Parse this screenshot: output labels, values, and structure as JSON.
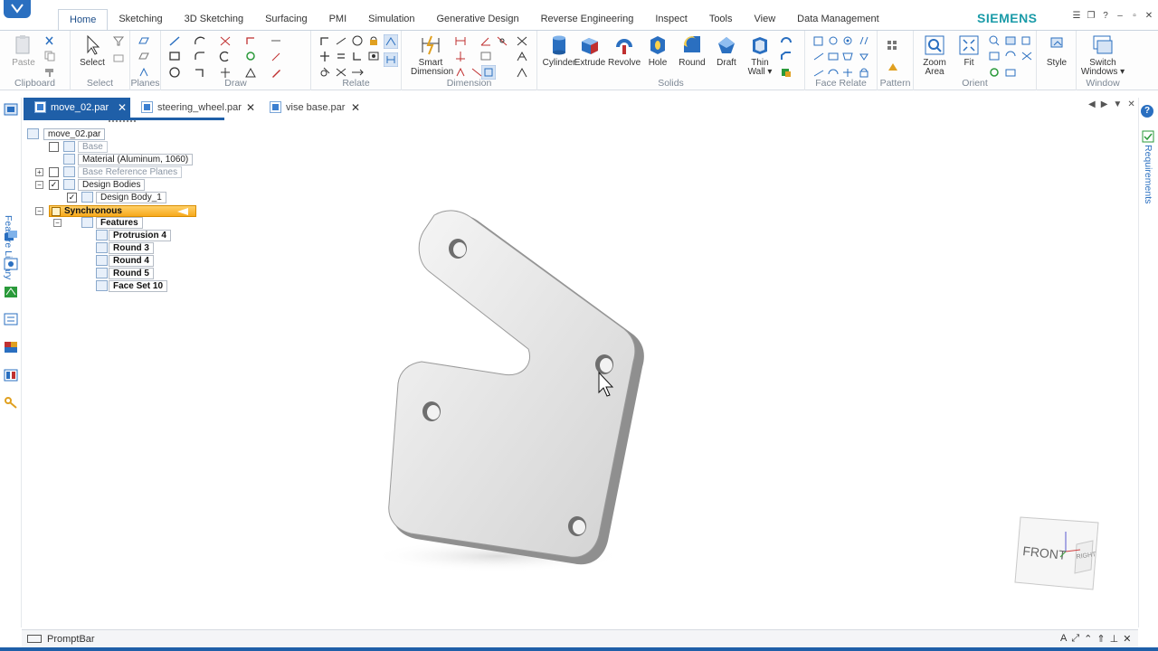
{
  "ribbon": {
    "tabs": [
      "Home",
      "Sketching",
      "3D Sketching",
      "Surfacing",
      "PMI",
      "Simulation",
      "Generative Design",
      "Reverse Engineering",
      "Inspect",
      "Tools",
      "View",
      "Data Management"
    ],
    "active_tab": "Home",
    "brand": "SIEMENS",
    "groups": {
      "clipboard": {
        "label": "Clipboard",
        "paste": "Paste"
      },
      "select": {
        "label": "Select",
        "select": "Select"
      },
      "planes": {
        "label": "Planes"
      },
      "draw": {
        "label": "Draw"
      },
      "relate": {
        "label": "Relate"
      },
      "dimension": {
        "label": "Dimension",
        "smart1": "Smart",
        "smart2": "Dimension"
      },
      "solids": {
        "label": "Solids",
        "cylinder": "Cylinder",
        "extrude": "Extrude",
        "revolve": "Revolve",
        "hole": "Hole",
        "round": "Round",
        "draft": "Draft",
        "thin1": "Thin",
        "thin2": "Wall ▾"
      },
      "face_relate": {
        "label": "Face Relate"
      },
      "pattern": {
        "label": "Pattern"
      },
      "orient": {
        "label": "Orient",
        "zoom1": "Zoom",
        "zoom2": "Area",
        "fit": "Fit"
      },
      "style": {
        "label": "Style"
      },
      "window": {
        "label": "Window",
        "switch1": "Switch",
        "switch2": "Windows ▾"
      }
    }
  },
  "doc_tabs": [
    "move_02.par",
    "steering_wheel.par",
    "vise base.par"
  ],
  "side": {
    "left_label": "Feature Library",
    "right_label": "Requirements"
  },
  "tree": {
    "root": "move_02.par",
    "base": "Base",
    "material": "Material (Aluminum, 1060)",
    "base_ref_planes": "Base Reference Planes",
    "design_bodies": "Design Bodies",
    "design_body_1": "Design Body_1",
    "synchronous": "Synchronous",
    "features": "Features",
    "feature_items": [
      "Protrusion 4",
      "Round 3",
      "Round 4",
      "Round 5",
      "Face Set 10"
    ]
  },
  "viewcube": {
    "front": "FRONT",
    "right": "RIGHT"
  },
  "promptbar": {
    "label": "PromptBar"
  },
  "colors": {
    "accent": "#1f5fa8",
    "brand": "#1a9ba8",
    "sync": "#f7a91c"
  }
}
